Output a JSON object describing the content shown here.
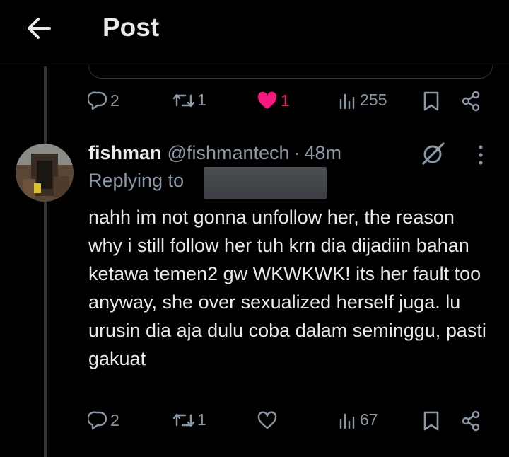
{
  "header": {
    "title": "Post",
    "back_icon": "arrow-left-icon"
  },
  "parent_actions": {
    "replies": "2",
    "reposts": "1",
    "likes": "1",
    "liked": true,
    "views": "255"
  },
  "reply": {
    "display_name": "fishman",
    "handle": "@fishmantech",
    "separator": "·",
    "time": "48m",
    "replying_label": "Replying to",
    "text": "nahh im not gonna unfollow her, the reason why i still follow her tuh krn dia dijadiin bahan ketawa temen2 gw WKWKWK! its her fault too anyway, she over sexualized herself juga. lu urusin dia aja dulu coba dalam seminggu, pasti gakuat",
    "actions": {
      "replies": "2",
      "reposts": "1",
      "likes": "",
      "liked": false,
      "views": "67"
    }
  },
  "colors": {
    "accent_like": "#f91880",
    "muted": "#8b98a5",
    "text": "#e7e9ea",
    "background": "#000000"
  }
}
